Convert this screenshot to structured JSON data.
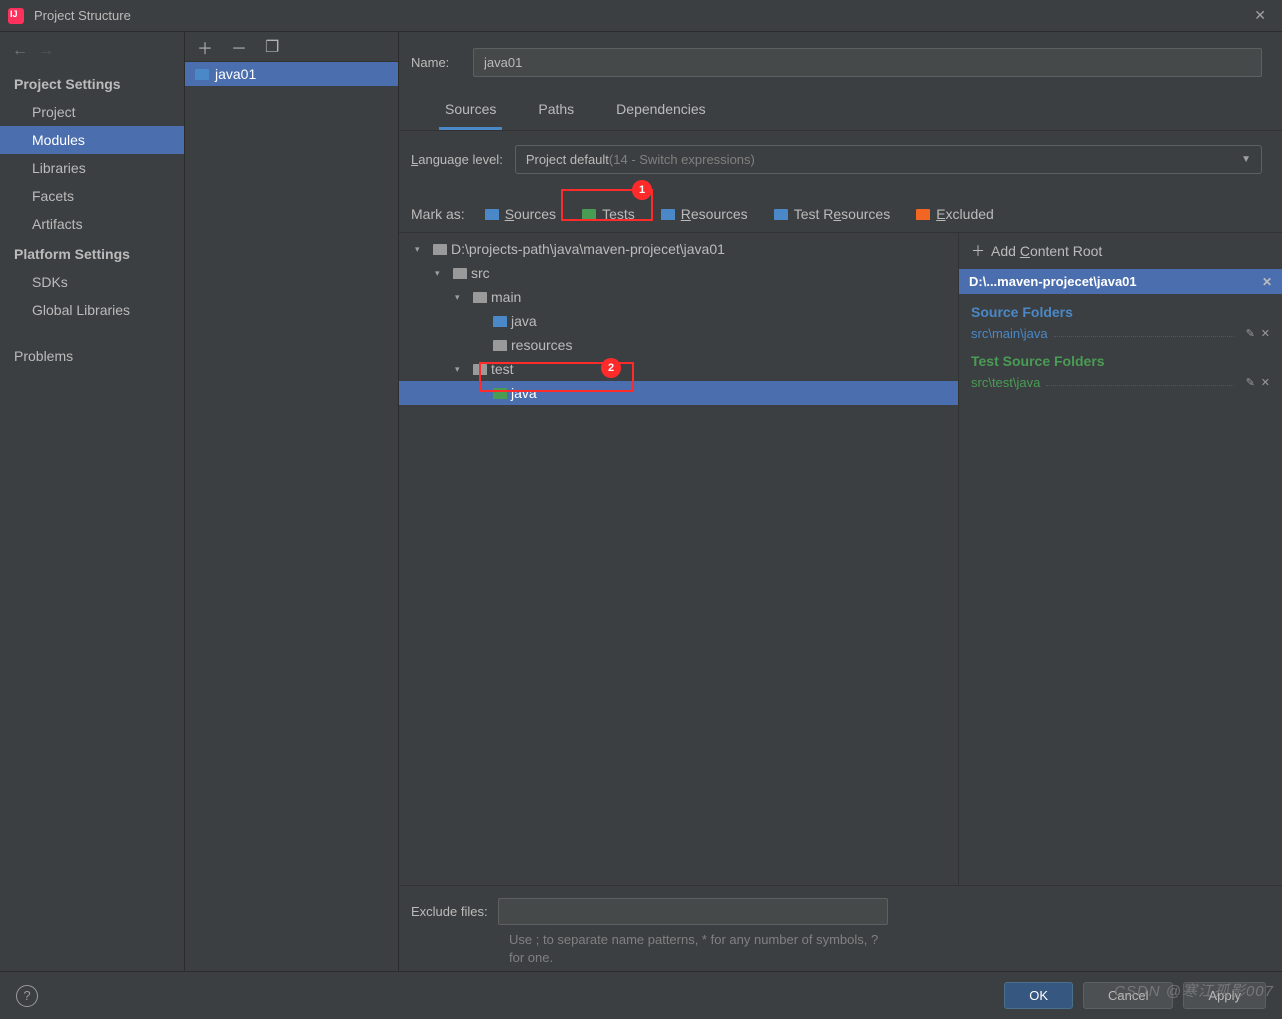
{
  "window": {
    "title": "Project Structure"
  },
  "sidebar": {
    "sections": [
      {
        "title": "Project Settings",
        "items": [
          "Project",
          "Modules",
          "Libraries",
          "Facets",
          "Artifacts"
        ],
        "selected": 1
      },
      {
        "title": "Platform Settings",
        "items": [
          "SDKs",
          "Global Libraries"
        ]
      }
    ],
    "problems": "Problems"
  },
  "modlist": {
    "module": "java01"
  },
  "detail": {
    "name_label": "Name:",
    "name_value": "java01",
    "tabs": [
      "Sources",
      "Paths",
      "Dependencies"
    ],
    "active_tab": 0,
    "lang_label": "Language level:",
    "lang_value": "Project default ",
    "lang_hint": "(14 - Switch expressions)"
  },
  "markas": {
    "label": "Mark as:",
    "buttons": [
      {
        "label": "Sources",
        "color": "blue-f",
        "ul": 0
      },
      {
        "label": "Tests",
        "color": "green-f",
        "ul": 0
      },
      {
        "label": "Resources",
        "color": "res-f",
        "ul": 0
      },
      {
        "label": "Test Resources",
        "color": "res-f",
        "ul": 5
      },
      {
        "label": "Excluded",
        "color": "orange-f",
        "ul": 0
      }
    ]
  },
  "tree": {
    "nodes": [
      {
        "depth": 0,
        "caret": "▾",
        "icon": "grey-f",
        "label": "D:\\projects-path\\java\\maven-projecet\\java01"
      },
      {
        "depth": 1,
        "caret": "▾",
        "icon": "grey-f",
        "label": "src"
      },
      {
        "depth": 2,
        "caret": "▾",
        "icon": "grey-f",
        "label": "main"
      },
      {
        "depth": 3,
        "caret": "",
        "icon": "blue-f",
        "label": "java"
      },
      {
        "depth": 3,
        "caret": "",
        "icon": "grey-f",
        "label": "resources"
      },
      {
        "depth": 2,
        "caret": "▾",
        "icon": "grey-f",
        "label": "test"
      },
      {
        "depth": 3,
        "caret": "",
        "icon": "green-f",
        "label": "java",
        "selected": true
      }
    ]
  },
  "sidepanel": {
    "add_root": "Add Content Root",
    "root_path": "D:\\...maven-projecet\\java01",
    "groups": [
      {
        "title": "Source Folders",
        "cls": "sf-blue",
        "items": [
          "src\\main\\java"
        ]
      },
      {
        "title": "Test Source Folders",
        "cls": "sf-green",
        "items": [
          "src\\test\\java"
        ]
      }
    ]
  },
  "exclude": {
    "label": "Exclude files:",
    "value": "",
    "hint": "Use ; to separate name patterns, * for any number of symbols, ? for one."
  },
  "footer": {
    "ok": "OK",
    "cancel": "Cancel",
    "apply": "Apply"
  },
  "annotations": {
    "badge1": "1",
    "badge2": "2"
  },
  "watermark": "CSDN @寒江孤影007"
}
